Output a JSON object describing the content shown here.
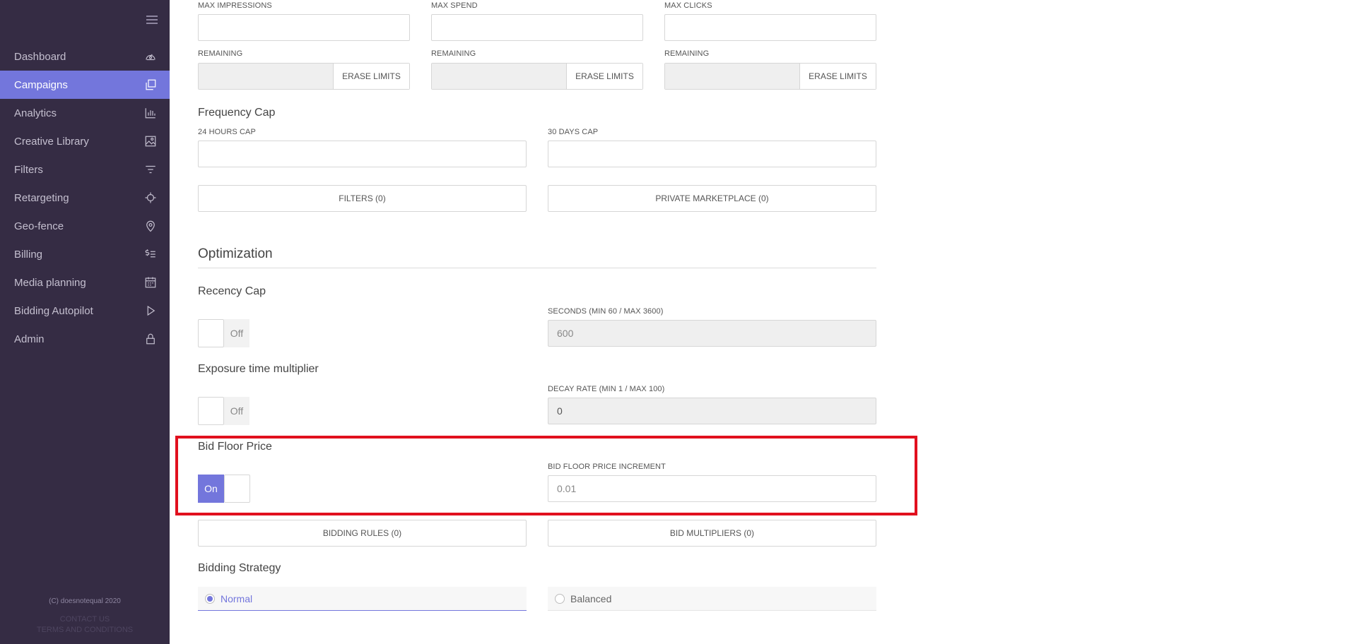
{
  "sidebar": {
    "menu_icon": "hamburger-icon",
    "items": [
      {
        "label": "Dashboard",
        "icon": "gauge-icon",
        "active": false
      },
      {
        "label": "Campaigns",
        "icon": "copy-icon",
        "active": true
      },
      {
        "label": "Analytics",
        "icon": "bar-chart-icon",
        "active": false
      },
      {
        "label": "Creative Library",
        "icon": "image-icon",
        "active": false
      },
      {
        "label": "Filters",
        "icon": "filter-icon",
        "active": false
      },
      {
        "label": "Retargeting",
        "icon": "crosshair-icon",
        "active": false
      },
      {
        "label": "Geo-fence",
        "icon": "map-pin-icon",
        "active": false
      },
      {
        "label": "Billing",
        "icon": "dollar-list-icon",
        "active": false
      },
      {
        "label": "Media planning",
        "icon": "calendar-icon",
        "active": false
      },
      {
        "label": "Bidding Autopilot",
        "icon": "play-icon",
        "active": false
      },
      {
        "label": "Admin",
        "icon": "lock-icon",
        "active": false
      }
    ],
    "footer": {
      "copyright": "(C) doesnotequal 2020",
      "contact": "CONTACT US",
      "terms": "TERMS AND CONDITIONS"
    }
  },
  "limits": {
    "max_impressions_label": "MAX IMPRESSIONS",
    "max_spend_label": "MAX SPEND",
    "max_clicks_label": "MAX CLICKS",
    "remaining_label": "REMAINING",
    "erase_limits_label": "ERASE LIMITS"
  },
  "frequency_cap": {
    "title": "Frequency Cap",
    "cap_24h_label": "24 HOURS CAP",
    "cap_30d_label": "30 DAYS CAP",
    "filters_button": "FILTERS (0)",
    "pmp_button": "PRIVATE MARKETPLACE (0)"
  },
  "optimization": {
    "title": "Optimization",
    "recency_cap": {
      "title": "Recency Cap",
      "toggle_state": "Off",
      "seconds_label": "SECONDS (MIN 60 / MAX 3600)",
      "seconds_value": "600"
    },
    "exposure": {
      "title": "Exposure time multiplier",
      "toggle_state": "Off",
      "decay_label": "DECAY RATE (MIN 1 / MAX 100)",
      "decay_value": "0"
    },
    "bid_floor": {
      "title": "Bid Floor Price",
      "toggle_state": "On",
      "increment_label": "BID FLOOR PRICE INCREMENT",
      "increment_value": "0.01"
    },
    "bidding_rules_button": "BIDDING RULES (0)",
    "bid_multipliers_button": "BID MULTIPLIERS (0)",
    "bidding_strategy": {
      "title": "Bidding Strategy",
      "options": [
        "Normal",
        "Balanced"
      ],
      "selected": "Normal"
    }
  },
  "colors": {
    "sidebar_bg": "#352c44",
    "accent": "#7376dc",
    "highlight": "#e1101e"
  }
}
